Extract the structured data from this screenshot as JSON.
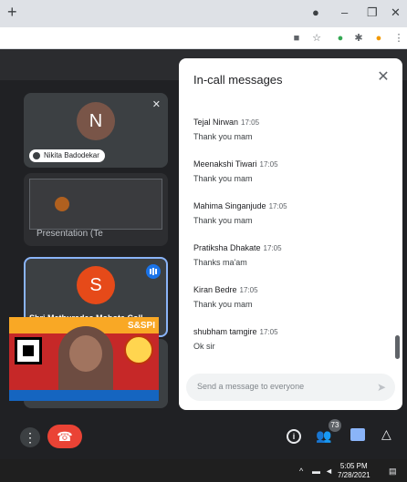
{
  "chat": {
    "title": "In-call messages",
    "placeholder": "Send a message to everyone",
    "messages": [
      {
        "sender": "Tejal Nirwan",
        "time": "17:05",
        "text": "Thank you mam"
      },
      {
        "sender": "Meenakshi Tiwari",
        "time": "17:05",
        "text": "Thank you mam"
      },
      {
        "sender": "Mahima Singanjude",
        "time": "17:05",
        "text": "Thank you mam"
      },
      {
        "sender": "Pratiksha Dhakate",
        "time": "17:05",
        "text": "Thanks ma'am"
      },
      {
        "sender": "Kiran Bedre",
        "time": "17:05",
        "text": "Thank you mam"
      },
      {
        "sender": "shubham tamgire",
        "time": "17:05",
        "text": "Ok sir"
      }
    ]
  },
  "tiles": {
    "nikita": {
      "initial": "N",
      "name": "Nikita Badodekar",
      "avatar_color": "#795548"
    },
    "presentation": {
      "label": "Presentation (Te"
    },
    "shri": {
      "initial": "S",
      "name": "Shri Mathuradas Mohota Coll...",
      "avatar_color": "#e64a19"
    }
  },
  "controls": {
    "participant_count": "73"
  },
  "poster": {
    "text": "S&SPI"
  },
  "taskbar": {
    "time": "5:05 PM",
    "date": "7/28/2021"
  },
  "colors": {
    "accent": "#1a73e8",
    "hangup": "#ea4335"
  }
}
